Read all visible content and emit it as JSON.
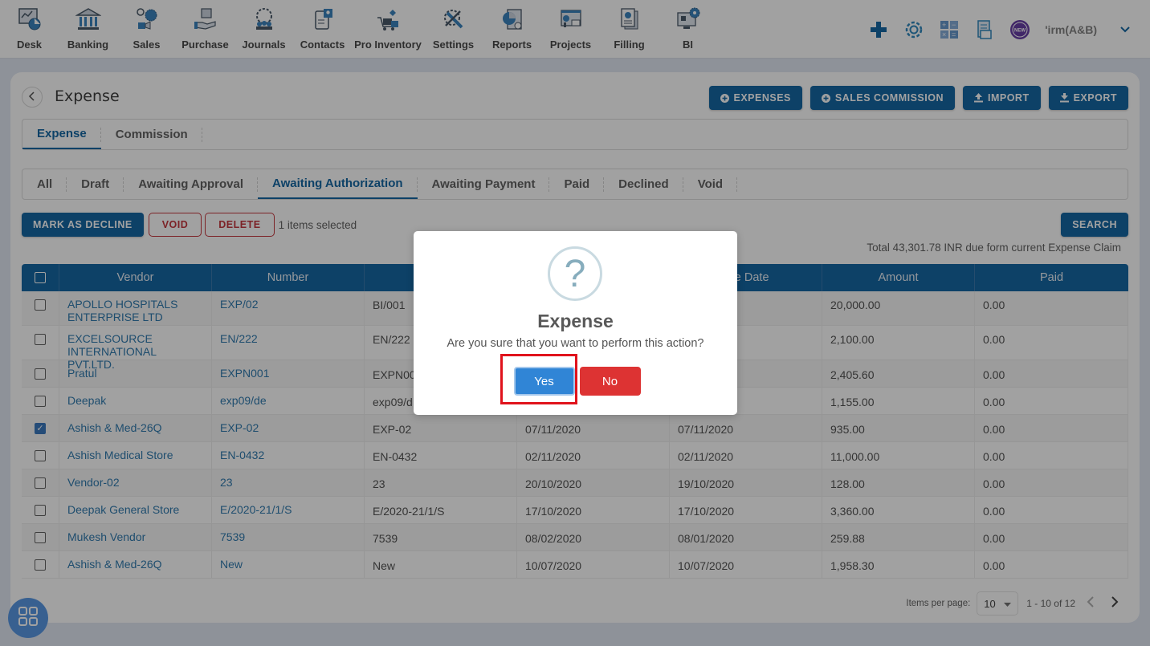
{
  "nav": {
    "items": [
      {
        "label": "Desk",
        "icon": "desk-icon"
      },
      {
        "label": "Banking",
        "icon": "bank-icon"
      },
      {
        "label": "Sales",
        "icon": "sales-icon"
      },
      {
        "label": "Purchase",
        "icon": "purchase-icon"
      },
      {
        "label": "Journals",
        "icon": "journals-icon"
      },
      {
        "label": "Contacts",
        "icon": "contacts-icon"
      },
      {
        "label": "Pro Inventory",
        "icon": "inventory-icon"
      },
      {
        "label": "Settings",
        "icon": "settings-tools-icon"
      },
      {
        "label": "Reports",
        "icon": "reports-icon"
      },
      {
        "label": "Projects",
        "icon": "projects-icon"
      },
      {
        "label": "Filling",
        "icon": "filling-icon"
      },
      {
        "label": "BI",
        "icon": "bi-icon"
      }
    ],
    "right": {
      "firm_label": "'irm(A&B)",
      "new_badge": "NEW"
    }
  },
  "page": {
    "title": "Expense",
    "actions": [
      {
        "label": "EXPENSES",
        "icon": "plus-circle-icon"
      },
      {
        "label": "SALES COMMISSION",
        "icon": "plus-circle-icon"
      },
      {
        "label": "IMPORT",
        "icon": "upload-icon"
      },
      {
        "label": "EXPORT",
        "icon": "download-icon"
      }
    ],
    "main_tabs": [
      {
        "label": "Expense",
        "active": true
      },
      {
        "label": "Commission",
        "active": false
      }
    ],
    "status_tabs": [
      {
        "label": "All",
        "active": false
      },
      {
        "label": "Draft",
        "active": false
      },
      {
        "label": "Awaiting Approval",
        "active": false
      },
      {
        "label": "Awaiting Authorization",
        "active": true
      },
      {
        "label": "Awaiting Payment",
        "active": false
      },
      {
        "label": "Paid",
        "active": false
      },
      {
        "label": "Declined",
        "active": false
      },
      {
        "label": "Void",
        "active": false
      }
    ],
    "bulk": {
      "mark_decline": "MARK AS DECLINE",
      "void": "VOID",
      "delete": "DELETE",
      "selected_text": "1 items selected"
    },
    "search_label": "SEARCH",
    "total_text": "Total 43,301.78 INR due form current Expense Claim"
  },
  "table": {
    "headers": [
      "Vendor",
      "Number",
      "",
      "",
      "nse Date",
      "Amount",
      "Paid"
    ],
    "rows": [
      {
        "checked": false,
        "vendor": "APOLLO HOSPITALS ENTERPRISE LTD",
        "number": "EXP/02",
        "ref": "BI/001",
        "date": "",
        "exp_date": "",
        "amount": "20,000.00",
        "paid": "0.00"
      },
      {
        "checked": false,
        "vendor": "EXCELSOURCE INTERNATIONAL PVT.LTD.",
        "number": "EN/222",
        "ref": "EN/222",
        "date": "",
        "exp_date": "",
        "amount": "2,100.00",
        "paid": "0.00"
      },
      {
        "checked": false,
        "vendor": "Pratul",
        "number": "EXPN001",
        "ref": "EXPN00",
        "date": "",
        "exp_date": "",
        "amount": "2,405.60",
        "paid": "0.00"
      },
      {
        "checked": false,
        "vendor": "Deepak",
        "number": "exp09/de",
        "ref": "exp09/d",
        "date": "",
        "exp_date": "",
        "amount": "1,155.00",
        "paid": "0.00"
      },
      {
        "checked": true,
        "vendor": "Ashish & Med-26Q",
        "number": "EXP-02",
        "ref": "EXP-02",
        "date": "07/11/2020",
        "exp_date": "07/11/2020",
        "amount": "935.00",
        "paid": "0.00"
      },
      {
        "checked": false,
        "vendor": "Ashish Medical Store",
        "number": "EN-0432",
        "ref": "EN-0432",
        "date": "02/11/2020",
        "exp_date": "02/11/2020",
        "amount": "11,000.00",
        "paid": "0.00"
      },
      {
        "checked": false,
        "vendor": "Vendor-02",
        "number": "23",
        "ref": "23",
        "date": "20/10/2020",
        "exp_date": "19/10/2020",
        "amount": "128.00",
        "paid": "0.00"
      },
      {
        "checked": false,
        "vendor": "Deepak General Store",
        "number": "E/2020-21/1/S",
        "ref": "E/2020-21/1/S",
        "date": "17/10/2020",
        "exp_date": "17/10/2020",
        "amount": "3,360.00",
        "paid": "0.00"
      },
      {
        "checked": false,
        "vendor": "Mukesh Vendor",
        "number": "7539",
        "ref": "7539",
        "date": "08/02/2020",
        "exp_date": "08/01/2020",
        "amount": "259.88",
        "paid": "0.00"
      },
      {
        "checked": false,
        "vendor": "Ashish & Med-26Q",
        "number": "New",
        "ref": "New",
        "date": "10/07/2020",
        "exp_date": "10/07/2020",
        "amount": "1,958.30",
        "paid": "0.00"
      }
    ]
  },
  "pagination": {
    "items_per_page_label": "Items per page:",
    "items_per_page": "10",
    "range": "1 - 10 of 12"
  },
  "modal": {
    "icon": "question-icon",
    "icon_glyph": "?",
    "title": "Expense",
    "message": "Are you sure that you want to perform this action?",
    "yes": "Yes",
    "no": "No"
  },
  "colors": {
    "primary": "#015a9c",
    "danger": "#c0262d",
    "confirm": "#3085d6",
    "cancel": "#dd3333",
    "highlight": "#e0131c"
  }
}
